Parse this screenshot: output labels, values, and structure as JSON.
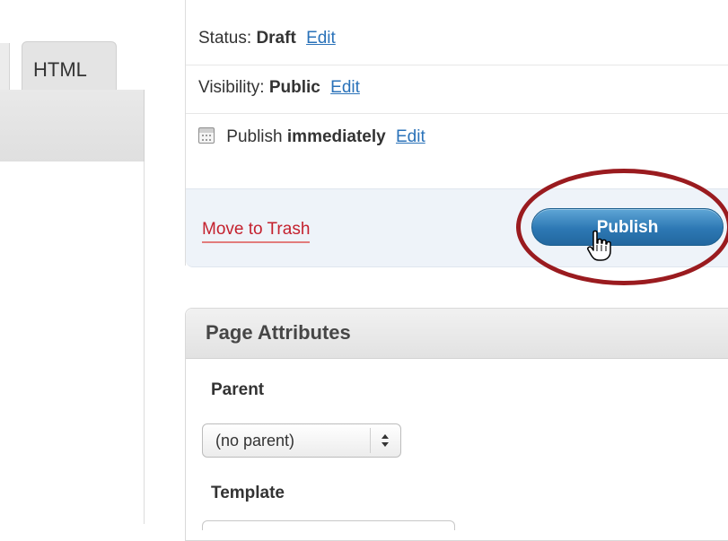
{
  "editor": {
    "tabs": [
      {
        "label": "HTML"
      }
    ]
  },
  "publish": {
    "status_label": "Status:",
    "status_value": "Draft",
    "visibility_label": "Visibility:",
    "visibility_value": "Public",
    "publish_label": "Publish",
    "publish_value": "immediately",
    "edit_label": "Edit",
    "trash_label": "Move to Trash",
    "publish_button_label": "Publish",
    "icons": {
      "calendar": "calendar-icon",
      "cursor": "hand-cursor-icon"
    },
    "annotation_color": "#9a1b1f",
    "button_color": "#2d78b4"
  },
  "page_attributes": {
    "title": "Page Attributes",
    "parent_label": "Parent",
    "parent_value": "(no parent)",
    "template_label": "Template"
  }
}
